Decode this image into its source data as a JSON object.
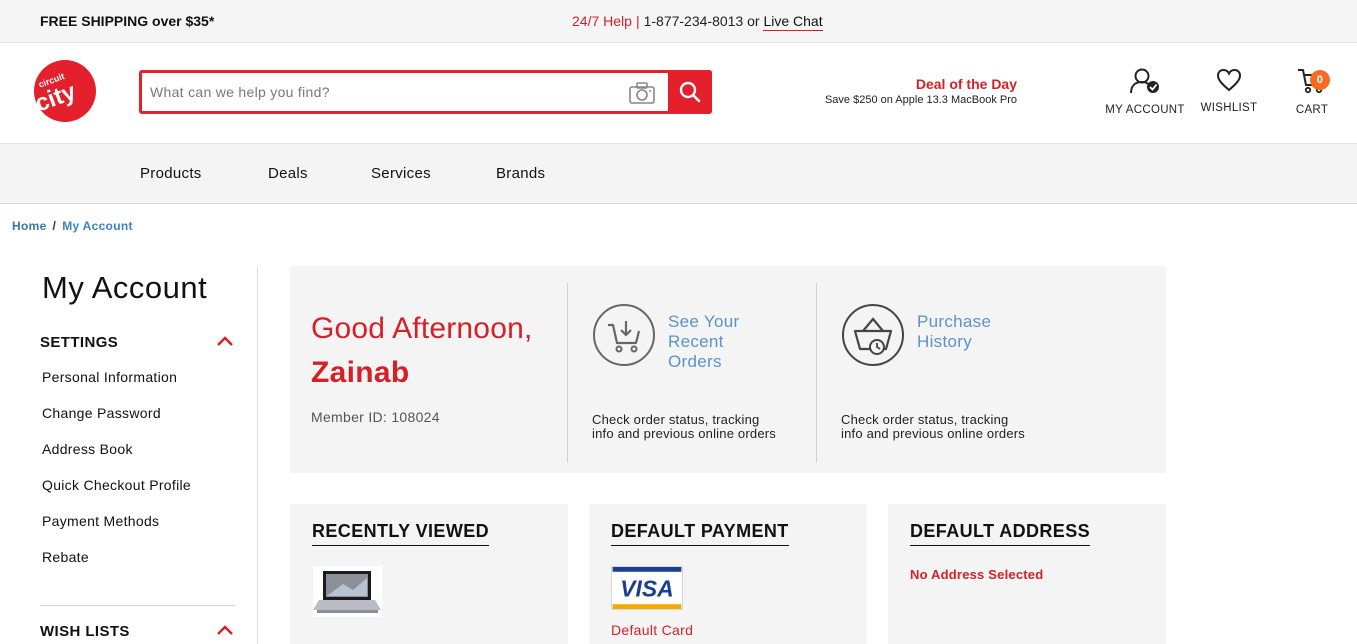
{
  "topbar": {
    "shipping": "FREE SHIPPING over $35*",
    "help": "24/7 Help",
    "separator": "|",
    "phone": "1-877-234-8013",
    "or": "or",
    "chat": "Live Chat"
  },
  "header": {
    "logo_text": "circuit city",
    "search_placeholder": "What can we help you find?",
    "deal_title": "Deal of the Day",
    "deal_text": "Save $250 on Apple 13.3 MacBook Pro",
    "account_label": "MY ACCOUNT",
    "wishlist_label": "WISHLIST",
    "cart_label": "CART",
    "cart_count": "0"
  },
  "nav": {
    "items": [
      "Products",
      "Deals",
      "Services",
      "Brands"
    ]
  },
  "breadcrumb": {
    "home": "Home",
    "slash": "/",
    "current": "My Account"
  },
  "sidebar": {
    "title": "My Account",
    "settings_heading": "SETTINGS",
    "links": [
      "Personal Information",
      "Change Password",
      "Address Book",
      "Quick Checkout Profile",
      "Payment Methods",
      "Rebate"
    ],
    "wishlists_heading": "WISH LISTS"
  },
  "greeting": {
    "line1": "Good Afternoon,",
    "name": "Zainab",
    "member_id": "Member ID: 108024"
  },
  "tiles": [
    {
      "title_lines": [
        "See Your",
        "Recent",
        "Orders"
      ],
      "desc_lines": [
        "Check order status, tracking",
        "info and previous online orders"
      ],
      "icon": "shopping-cart-icon"
    },
    {
      "title_lines": [
        "Purchase",
        "History"
      ],
      "desc_lines": [
        "Check order status, tracking",
        "info and previous online orders"
      ],
      "icon": "basket-clock-icon"
    }
  ],
  "cards": {
    "recent_title": "RECENTLY VIEWED",
    "payment_title": "DEFAULT PAYMENT",
    "payment_card": "Default Card",
    "visa_text": "VISA",
    "address_title": "DEFAULT ADDRESS",
    "address_empty": "No Address Selected"
  },
  "colors": {
    "brand_red": "#d62027",
    "link_blue": "#5b93c9",
    "badge_orange": "#f36c21"
  }
}
